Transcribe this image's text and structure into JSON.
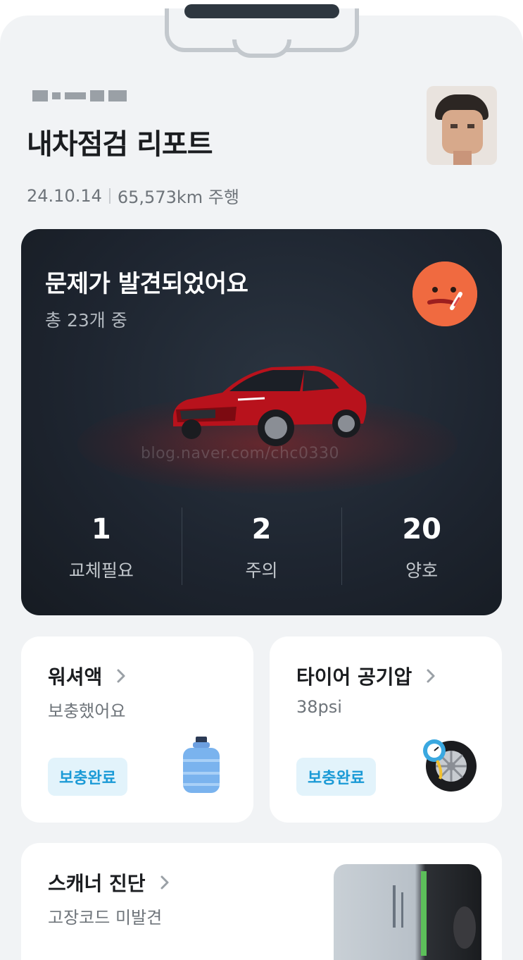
{
  "header": {
    "title": "내차점검 리포트",
    "date": "24.10.14",
    "mileage": "65,573km 주행"
  },
  "status_card": {
    "title": "문제가 발견되었어요",
    "subtitle": "총 23개 중",
    "watermark": "blog.naver.com/chc0330",
    "stats": [
      {
        "value": "1",
        "label": "교체필요"
      },
      {
        "value": "2",
        "label": "주의"
      },
      {
        "value": "20",
        "label": "양호"
      }
    ]
  },
  "cards": {
    "washer": {
      "title": "워셔액",
      "subtitle": "보충했어요",
      "badge": "보충완료",
      "icon": "water-bottle-icon"
    },
    "tire": {
      "title": "타이어 공기압",
      "subtitle": "38psi",
      "badge": "보충완료",
      "icon": "tire-gauge-icon"
    },
    "scanner": {
      "title": "스캐너 진단",
      "subtitle": "고장코드 미발견"
    }
  },
  "colors": {
    "accent_blue": "#1a9ad6",
    "badge_bg": "#e2f3fb",
    "status_card_bg": "#1e2530",
    "emoji_bg": "#f06a40"
  }
}
